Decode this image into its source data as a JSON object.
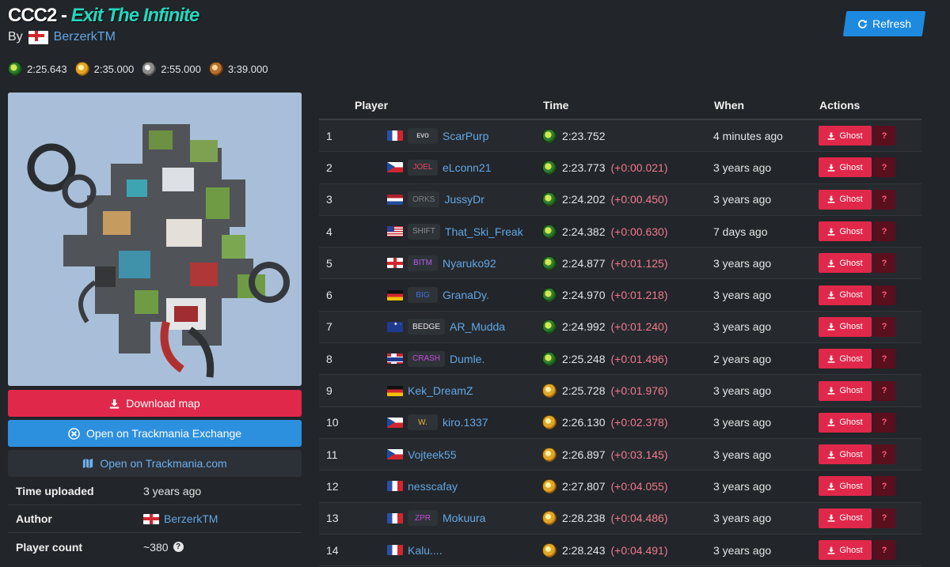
{
  "header": {
    "title_prefix": "CCC2",
    "title_separator": "-",
    "title_name": "Exit The Infinite",
    "by_label": "By",
    "author": "BerzerkTM",
    "refresh_label": "Refresh"
  },
  "medals": [
    {
      "type": "author",
      "time": "2:25.643"
    },
    {
      "type": "gold",
      "time": "2:35.000"
    },
    {
      "type": "silver",
      "time": "2:55.000"
    },
    {
      "type": "bronze",
      "time": "3:39.000"
    }
  ],
  "map_image": {
    "description_icon": "map-thumbnail",
    "background": "#a9bfd9"
  },
  "buttons": {
    "download": "Download map",
    "tmx": "Open on Trackmania Exchange",
    "tmcom": "Open on Trackmania.com"
  },
  "info": {
    "time_uploaded_label": "Time uploaded",
    "time_uploaded_value": "3 years ago",
    "author_label": "Author",
    "author_value": "BerzerkTM",
    "player_count_label": "Player count",
    "player_count_value": "~380"
  },
  "leaderboard": {
    "headers": {
      "player": "Player",
      "time": "Time",
      "when": "When",
      "actions": "Actions"
    },
    "ghost_label": "Ghost",
    "help_label": "?",
    "rows": [
      {
        "rank": "1",
        "flag": "fr",
        "tag": "ᴇᴠᴏ",
        "tag_color": "#e8e8e8",
        "name": "ScarPurp",
        "medal": "author",
        "time": "2:23.752",
        "delta": "",
        "when": "4 minutes ago"
      },
      {
        "rank": "2",
        "flag": "cz",
        "tag": "JOEL",
        "tag_color": "#e8445f",
        "name": "eLconn21",
        "medal": "author",
        "time": "2:23.773",
        "delta": "(+0:00.021)",
        "when": "3 years ago"
      },
      {
        "rank": "3",
        "flag": "nl",
        "tag": "ORKS",
        "tag_color": "#7b7f85",
        "name": "JussyDr",
        "medal": "author",
        "time": "2:24.202",
        "delta": "(+0:00.450)",
        "when": "3 years ago"
      },
      {
        "rank": "4",
        "flag": "us",
        "tag": "SHIFT",
        "tag_color": "#8a8e94",
        "name": "That_Ski_Freak",
        "medal": "author",
        "time": "2:24.382",
        "delta": "(+0:00.630)",
        "when": "7 days ago"
      },
      {
        "rank": "5",
        "flag": "en",
        "tag": "BITM",
        "tag_color": "#b45cf0",
        "name": "Nyaruko92",
        "medal": "author",
        "time": "2:24.877",
        "delta": "(+0:01.125)",
        "when": "3 years ago"
      },
      {
        "rank": "6",
        "flag": "de",
        "tag": "BIG",
        "tag_color": "#3f6fe0",
        "name": "GranaDy.",
        "medal": "author",
        "time": "2:24.970",
        "delta": "(+0:01.218)",
        "when": "3 years ago"
      },
      {
        "rank": "7",
        "flag": "au",
        "tag": "BEDGE",
        "tag_color": "#e8e8e8",
        "name": "AR_Mudda",
        "medal": "author",
        "time": "2:24.992",
        "delta": "(+0:01.240)",
        "when": "3 years ago"
      },
      {
        "rank": "8",
        "flag": "no",
        "tag": "CRASH",
        "tag_color": "#c24cd6",
        "name": "Dumle.",
        "medal": "author",
        "time": "2:25.248",
        "delta": "(+0:01.496)",
        "when": "2 years ago"
      },
      {
        "rank": "9",
        "flag": "de",
        "tag": "",
        "tag_color": "",
        "name": "Kek_DreamZ",
        "medal": "gold",
        "time": "2:25.728",
        "delta": "(+0:01.976)",
        "when": "3 years ago"
      },
      {
        "rank": "10",
        "flag": "cz",
        "tag": "W.",
        "tag_color": "#e8b32e",
        "name": "kiro.1337",
        "medal": "gold",
        "time": "2:26.130",
        "delta": "(+0:02.378)",
        "when": "3 years ago"
      },
      {
        "rank": "11",
        "flag": "cz",
        "tag": "",
        "tag_color": "",
        "name": "Vojteek55",
        "medal": "gold",
        "time": "2:26.897",
        "delta": "(+0:03.145)",
        "when": "3 years ago"
      },
      {
        "rank": "12",
        "flag": "fr",
        "tag": "",
        "tag_color": "",
        "name": "nesscafay",
        "medal": "gold",
        "time": "2:27.807",
        "delta": "(+0:04.055)",
        "when": "3 years ago"
      },
      {
        "rank": "13",
        "flag": "fr",
        "tag": "ZPR",
        "tag_color": "#c24cd6",
        "name": "Mokuura",
        "medal": "gold",
        "time": "2:28.238",
        "delta": "(+0:04.486)",
        "when": "3 years ago"
      },
      {
        "rank": "14",
        "flag": "fr",
        "tag": "",
        "tag_color": "",
        "name": "Kalu....",
        "medal": "gold",
        "time": "2:28.243",
        "delta": "(+0:04.491)",
        "when": "3 years ago"
      }
    ]
  }
}
